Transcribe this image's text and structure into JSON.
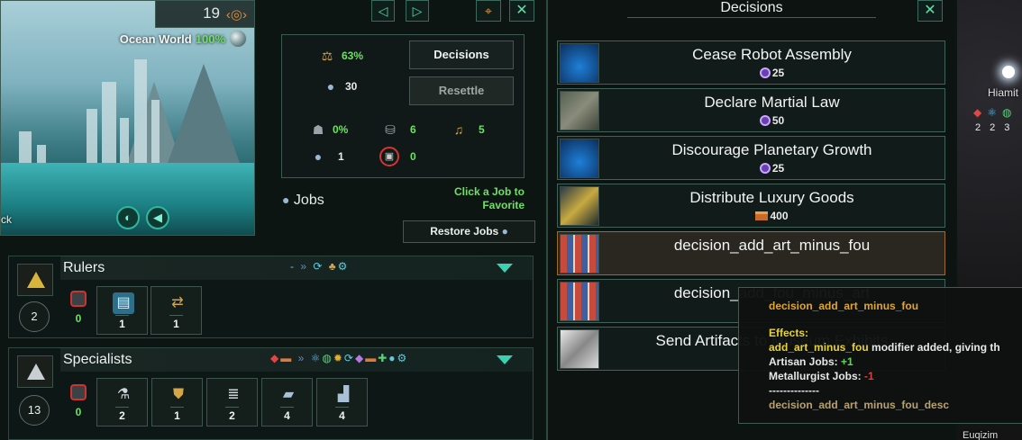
{
  "planet": {
    "size": "19",
    "size_icon": "planet-size-icon",
    "class_name": "Ocean World",
    "habitability": "100%",
    "left_label": "ck"
  },
  "nav": {
    "prev_icon": "◁",
    "next_icon": "▷",
    "focus_icon": "⌖",
    "close_icon": "✕"
  },
  "stats": {
    "stability": "63%",
    "pops": "30",
    "crime": "0%",
    "amenities": "6",
    "happiness": "5",
    "free_housing": "1",
    "unemployed": "0"
  },
  "buttons": {
    "decisions": "Decisions",
    "resettle": "Resettle",
    "restore_jobs": "Restore Jobs"
  },
  "jobs": {
    "title": "Jobs",
    "hint": "Click a Job to Favorite"
  },
  "strata": [
    {
      "name": "Rulers",
      "separator": "-",
      "pop_count": "2",
      "unemployed": "0",
      "jobs": [
        {
          "icon": "clipboard-icon",
          "count": "1"
        },
        {
          "icon": "trade-icon",
          "count": "1"
        }
      ]
    },
    {
      "name": "Specialists",
      "pop_count": "13",
      "unemployed": "0",
      "jobs": [
        {
          "icon": "microscope-icon",
          "count": "2"
        },
        {
          "icon": "badge-icon",
          "count": "1"
        },
        {
          "icon": "books-icon",
          "count": "2"
        },
        {
          "icon": "alloy-icon",
          "count": "4"
        },
        {
          "icon": "factory-icon",
          "count": "4"
        }
      ]
    }
  ],
  "decisions_panel": {
    "title": "Decisions",
    "items": [
      {
        "title": "Cease Robot Assembly",
        "cost": "25",
        "cost_type": "influence"
      },
      {
        "title": "Declare Martial Law",
        "cost": "50",
        "cost_type": "influence"
      },
      {
        "title": "Discourage Planetary Growth",
        "cost": "25",
        "cost_type": "influence"
      },
      {
        "title": "Distribute Luxury Goods",
        "cost": "400",
        "cost_type": "consumer-goods"
      },
      {
        "title": "decision_add_art_minus_fou",
        "cost": "",
        "cost_type": ""
      },
      {
        "title": "decision_add_fou_minus_art",
        "cost": "",
        "cost_type": ""
      },
      {
        "title": "Send Artifacts to Museum Exhibits",
        "cost": "",
        "cost_type": ""
      }
    ]
  },
  "tooltip": {
    "title": "decision_add_art_minus_fou",
    "effects_label": "Effects:",
    "modifier_name": "add_art_minus_fou",
    "modifier_text": "modifier added, giving th",
    "artisan_label": "Artisan Jobs:",
    "artisan_value": "+1",
    "metallurgist_label": "Metallurgist Jobs:",
    "metallurgist_value": "-1",
    "separator": "--------------",
    "desc": "decision_add_art_minus_fou_desc"
  },
  "map": {
    "system_name": "Hiamit",
    "resources": [
      "2",
      "2",
      "3"
    ],
    "bottom_label": "Euqizim"
  }
}
